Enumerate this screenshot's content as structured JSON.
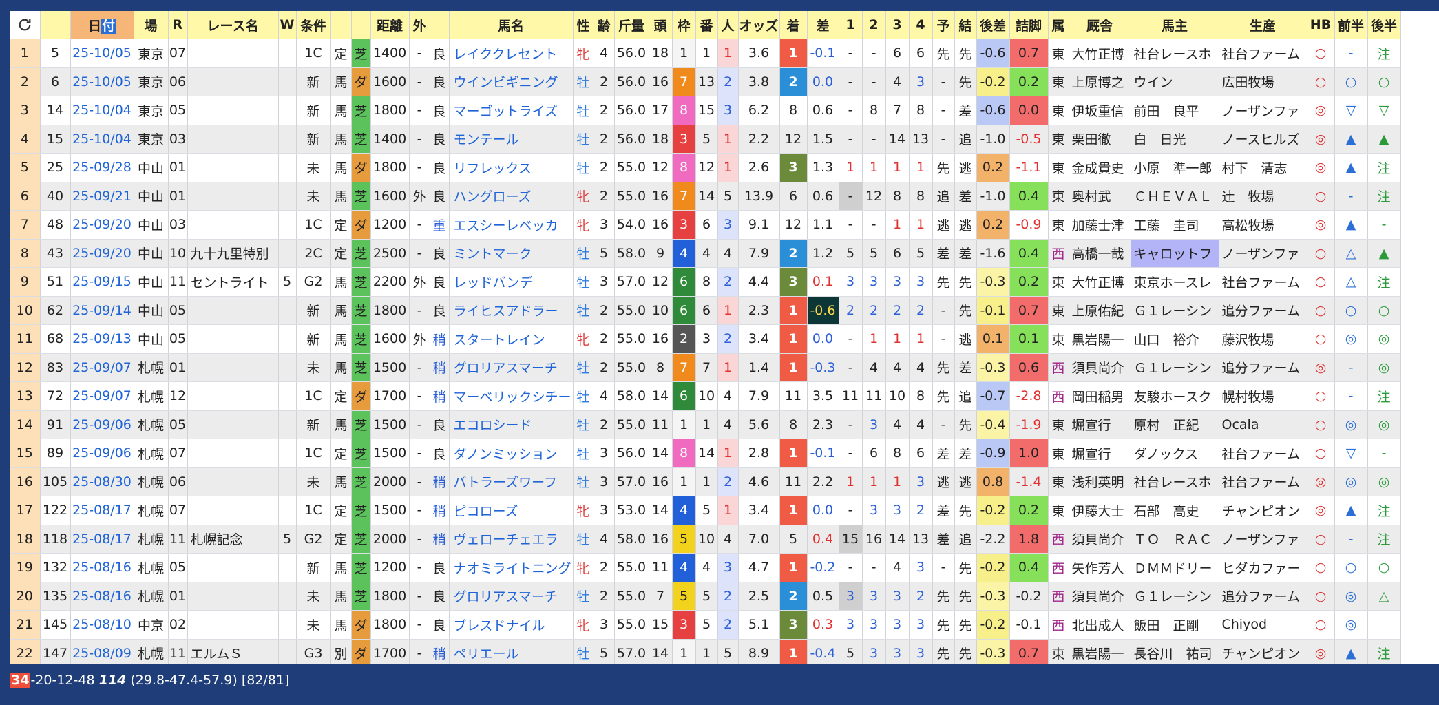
{
  "headers": [
    "日付",
    "場",
    "R",
    "レース名",
    "W",
    "条件",
    "",
    "",
    "距離",
    "外",
    "",
    "馬名",
    "性",
    "齢",
    "斤量",
    "頭",
    "枠",
    "番",
    "人",
    "オッズ",
    "着",
    "差",
    "1",
    "2",
    "3",
    "4",
    "予",
    "結",
    "後差",
    "詰脚",
    "属",
    "厩舎",
    "馬主",
    "生産",
    "HB",
    "前半",
    "後半"
  ],
  "header_date_prefix": "日",
  "header_date_selected": "付",
  "rows": [
    {
      "n": "1",
      "id": "5",
      "date": "25-10/05",
      "ba": "東京",
      "r": "07",
      "name": "",
      "w": "",
      "jo": "1C",
      "t": "定",
      "surf": "芝",
      "dist": "1400",
      "out": "-",
      "baba": "良",
      "horse": "レイククレセント",
      "sex": "牝",
      "age": "4",
      "kin": "56.0",
      "to": "18",
      "waku": "1",
      "ban": "1",
      "nin": "1",
      "odds": "3.6",
      "chaku": "1",
      "sa": "-0.1",
      "c1": "-",
      "c2": "-",
      "c3": "6",
      "c4": "6",
      "yo": "先",
      "ke": "先",
      "ato": "-0.6",
      "tsume": "0.7",
      "zoku": "東",
      "kyu": "大竹正博",
      "owner": "社台レースホ",
      "prod": "社台ファーム",
      "hb": "○",
      "zen": "-",
      "kou": "注"
    },
    {
      "n": "2",
      "id": "6",
      "date": "25-10/05",
      "ba": "東京",
      "r": "06",
      "name": "",
      "w": "",
      "jo": "新",
      "t": "馬",
      "surf": "ダ",
      "dist": "1600",
      "out": "-",
      "baba": "良",
      "horse": "ウインビギニング",
      "sex": "牡",
      "age": "2",
      "kin": "56.0",
      "to": "16",
      "waku": "7",
      "ban": "13",
      "nin": "2",
      "odds": "3.8",
      "chaku": "2",
      "sa": "0.0",
      "c1": "-",
      "c2": "-",
      "c3": "4",
      "c4": "3",
      "yo": "-",
      "ke": "先",
      "ato": "-0.2",
      "tsume": "0.2",
      "zoku": "東",
      "kyu": "上原博之",
      "owner": "ウイン",
      "prod": "広田牧場",
      "hb": "○",
      "zen": "○",
      "kou": "○"
    },
    {
      "n": "3",
      "id": "14",
      "date": "25-10/04",
      "ba": "東京",
      "r": "05",
      "name": "",
      "w": "",
      "jo": "新",
      "t": "馬",
      "surf": "芝",
      "dist": "1800",
      "out": "-",
      "baba": "良",
      "horse": "マーゴットライズ",
      "sex": "牡",
      "age": "2",
      "kin": "56.0",
      "to": "17",
      "waku": "8",
      "ban": "15",
      "nin": "3",
      "odds": "6.2",
      "chaku": "8",
      "sa": "0.6",
      "c1": "-",
      "c2": "8",
      "c3": "7",
      "c4": "8",
      "yo": "-",
      "ke": "差",
      "ato": "-0.6",
      "tsume": "0.0",
      "zoku": "東",
      "kyu": "伊坂重信",
      "owner": "前田　良平",
      "prod": "ノーザンファ",
      "hb": "◎",
      "zen": "▽",
      "kou": "▽"
    },
    {
      "n": "4",
      "id": "15",
      "date": "25-10/04",
      "ba": "東京",
      "r": "03",
      "name": "",
      "w": "",
      "jo": "新",
      "t": "馬",
      "surf": "芝",
      "dist": "1400",
      "out": "-",
      "baba": "良",
      "horse": "モンテール",
      "sex": "牡",
      "age": "2",
      "kin": "56.0",
      "to": "18",
      "waku": "3",
      "ban": "5",
      "nin": "1",
      "odds": "2.2",
      "chaku": "12",
      "sa": "1.5",
      "c1": "-",
      "c2": "-",
      "c3": "14",
      "c4": "13",
      "yo": "-",
      "ke": "追",
      "ato": "-1.0",
      "tsume": "-0.5",
      "zoku": "東",
      "kyu": "栗田徹",
      "owner": "白　日光",
      "prod": "ノースヒルズ",
      "hb": "◎",
      "zen": "▲",
      "kou": "▲"
    },
    {
      "n": "5",
      "id": "25",
      "date": "25-09/28",
      "ba": "中山",
      "r": "01",
      "name": "",
      "w": "",
      "jo": "未",
      "t": "馬",
      "surf": "ダ",
      "dist": "1800",
      "out": "-",
      "baba": "良",
      "horse": "リフレックス",
      "sex": "牡",
      "age": "2",
      "kin": "55.0",
      "to": "12",
      "waku": "8",
      "ban": "12",
      "nin": "1",
      "odds": "2.6",
      "chaku": "3",
      "sa": "1.3",
      "c1": "1",
      "c2": "1",
      "c3": "1",
      "c4": "1",
      "yo": "先",
      "ke": "逃",
      "ato": "0.2",
      "tsume": "-1.1",
      "zoku": "東",
      "kyu": "金成貴史",
      "owner": "小原　準一郎",
      "prod": "村下　清志",
      "hb": "◎",
      "zen": "▲",
      "kou": "注"
    },
    {
      "n": "6",
      "id": "40",
      "date": "25-09/21",
      "ba": "中山",
      "r": "01",
      "name": "",
      "w": "",
      "jo": "未",
      "t": "馬",
      "surf": "芝",
      "dist": "1600",
      "out": "外",
      "baba": "良",
      "horse": "ハングローズ",
      "sex": "牝",
      "age": "2",
      "kin": "55.0",
      "to": "16",
      "waku": "7",
      "ban": "14",
      "nin": "5",
      "odds": "13.9",
      "chaku": "6",
      "sa": "0.6",
      "c1": "-",
      "c2": "12",
      "c3": "8",
      "c4": "8",
      "yo": "追",
      "ke": "差",
      "ato": "-1.0",
      "tsume": "0.4",
      "zoku": "東",
      "kyu": "奥村武",
      "owner": "ＣＨＥＶＡＬ",
      "prod": "辻　牧場",
      "hb": "○",
      "zen": "-",
      "kou": "注"
    },
    {
      "n": "7",
      "id": "48",
      "date": "25-09/20",
      "ba": "中山",
      "r": "03",
      "name": "",
      "w": "",
      "jo": "1C",
      "t": "定",
      "surf": "ダ",
      "dist": "1200",
      "out": "-",
      "baba": "重",
      "horse": "エスシーレベッカ",
      "sex": "牝",
      "age": "3",
      "kin": "54.0",
      "to": "16",
      "waku": "3",
      "ban": "6",
      "nin": "3",
      "odds": "9.1",
      "chaku": "12",
      "sa": "1.1",
      "c1": "-",
      "c2": "-",
      "c3": "1",
      "c4": "1",
      "yo": "逃",
      "ke": "逃",
      "ato": "0.2",
      "tsume": "-0.9",
      "zoku": "東",
      "kyu": "加藤士津",
      "owner": "工藤　圭司",
      "prod": "高松牧場",
      "hb": "◎",
      "zen": "▲",
      "kou": "-"
    },
    {
      "n": "8",
      "id": "43",
      "date": "25-09/20",
      "ba": "中山",
      "r": "10",
      "name": "九十九里特別",
      "w": "",
      "jo": "2C",
      "t": "定",
      "surf": "芝",
      "dist": "2500",
      "out": "-",
      "baba": "良",
      "horse": "ミントマーク",
      "sex": "牡",
      "age": "5",
      "kin": "58.0",
      "to": "9",
      "waku": "4",
      "ban": "4",
      "nin": "4",
      "odds": "7.9",
      "chaku": "2",
      "sa": "1.2",
      "c1": "5",
      "c2": "5",
      "c3": "6",
      "c4": "5",
      "yo": "差",
      "ke": "差",
      "ato": "-1.6",
      "tsume": "0.4",
      "zoku": "西",
      "kyu": "高橋一哉",
      "owner": "キャロットフ",
      "prod": "ノーザンファ",
      "hb": "○",
      "zen": "△",
      "kou": "▲"
    },
    {
      "n": "9",
      "id": "51",
      "date": "25-09/15",
      "ba": "中山",
      "r": "11",
      "name": "セントライト",
      "w": "5",
      "jo": "G2",
      "t": "馬",
      "surf": "芝",
      "dist": "2200",
      "out": "外",
      "baba": "良",
      "horse": "レッドバンデ",
      "sex": "牡",
      "age": "3",
      "kin": "57.0",
      "to": "12",
      "waku": "6",
      "ban": "8",
      "nin": "2",
      "odds": "4.4",
      "chaku": "3",
      "sa": "0.1",
      "c1": "3",
      "c2": "3",
      "c3": "3",
      "c4": "3",
      "yo": "先",
      "ke": "先",
      "ato": "-0.3",
      "tsume": "0.2",
      "zoku": "東",
      "kyu": "大竹正博",
      "owner": "東京ホースレ",
      "prod": "社台ファーム",
      "hb": "○",
      "zen": "△",
      "kou": "注"
    },
    {
      "n": "10",
      "id": "62",
      "date": "25-09/14",
      "ba": "中山",
      "r": "05",
      "name": "",
      "w": "",
      "jo": "新",
      "t": "馬",
      "surf": "芝",
      "dist": "1800",
      "out": "-",
      "baba": "良",
      "horse": "ライヒスアドラー",
      "sex": "牡",
      "age": "2",
      "kin": "55.0",
      "to": "10",
      "waku": "6",
      "ban": "6",
      "nin": "1",
      "odds": "2.3",
      "chaku": "1",
      "sa": "-0.6",
      "c1": "2",
      "c2": "2",
      "c3": "2",
      "c4": "2",
      "yo": "-",
      "ke": "先",
      "ato": "-0.1",
      "tsume": "0.7",
      "zoku": "東",
      "kyu": "上原佑紀",
      "owner": "Ｇ１レーシン",
      "prod": "追分ファーム",
      "hb": "○",
      "zen": "○",
      "kou": "○"
    },
    {
      "n": "11",
      "id": "68",
      "date": "25-09/13",
      "ba": "中山",
      "r": "05",
      "name": "",
      "w": "",
      "jo": "新",
      "t": "馬",
      "surf": "芝",
      "dist": "1600",
      "out": "外",
      "baba": "稍",
      "horse": "スタートレイン",
      "sex": "牝",
      "age": "2",
      "kin": "55.0",
      "to": "16",
      "waku": "2",
      "ban": "3",
      "nin": "2",
      "odds": "3.4",
      "chaku": "1",
      "sa": "0.0",
      "c1": "-",
      "c2": "1",
      "c3": "1",
      "c4": "1",
      "yo": "-",
      "ke": "逃",
      "ato": "0.1",
      "tsume": "0.1",
      "zoku": "東",
      "kyu": "黒岩陽一",
      "owner": "山口　裕介",
      "prod": "藤沢牧場",
      "hb": "○",
      "zen": "◎",
      "kou": "◎"
    },
    {
      "n": "12",
      "id": "83",
      "date": "25-09/07",
      "ba": "札幌",
      "r": "01",
      "name": "",
      "w": "",
      "jo": "未",
      "t": "馬",
      "surf": "芝",
      "dist": "1500",
      "out": "-",
      "baba": "稍",
      "horse": "グロリアスマーチ",
      "sex": "牡",
      "age": "2",
      "kin": "55.0",
      "to": "8",
      "waku": "7",
      "ban": "7",
      "nin": "1",
      "odds": "1.4",
      "chaku": "1",
      "sa": "-0.3",
      "c1": "-",
      "c2": "4",
      "c3": "4",
      "c4": "4",
      "yo": "先",
      "ke": "差",
      "ato": "-0.3",
      "tsume": "0.6",
      "zoku": "西",
      "kyu": "須貝尚介",
      "owner": "Ｇ１レーシン",
      "prod": "追分ファーム",
      "hb": "◎",
      "zen": "-",
      "kou": "◎"
    },
    {
      "n": "13",
      "id": "72",
      "date": "25-09/07",
      "ba": "札幌",
      "r": "12",
      "name": "",
      "w": "",
      "jo": "1C",
      "t": "定",
      "surf": "ダ",
      "dist": "1700",
      "out": "-",
      "baba": "稍",
      "horse": "マーベリックシチー",
      "sex": "牡",
      "age": "4",
      "kin": "58.0",
      "to": "14",
      "waku": "6",
      "ban": "10",
      "nin": "4",
      "odds": "7.9",
      "chaku": "11",
      "sa": "3.5",
      "c1": "11",
      "c2": "11",
      "c3": "10",
      "c4": "8",
      "yo": "先",
      "ke": "追",
      "ato": "-0.7",
      "tsume": "-2.8",
      "zoku": "西",
      "kyu": "岡田稲男",
      "owner": "友駿ホースク",
      "prod": "幌村牧場",
      "hb": "○",
      "zen": "-",
      "kou": "注"
    },
    {
      "n": "14",
      "id": "91",
      "date": "25-09/06",
      "ba": "札幌",
      "r": "05",
      "name": "",
      "w": "",
      "jo": "新",
      "t": "馬",
      "surf": "芝",
      "dist": "1500",
      "out": "-",
      "baba": "良",
      "horse": "エコロシード",
      "sex": "牡",
      "age": "2",
      "kin": "55.0",
      "to": "11",
      "waku": "1",
      "ban": "1",
      "nin": "4",
      "odds": "5.6",
      "chaku": "8",
      "sa": "2.3",
      "c1": "-",
      "c2": "3",
      "c3": "4",
      "c4": "4",
      "yo": "-",
      "ke": "先",
      "ato": "-0.4",
      "tsume": "-1.9",
      "zoku": "東",
      "kyu": "堀宣行",
      "owner": "原村　正紀",
      "prod": "Ocala",
      "hb": "○",
      "zen": "◎",
      "kou": "◎"
    },
    {
      "n": "15",
      "id": "89",
      "date": "25-09/06",
      "ba": "札幌",
      "r": "07",
      "name": "",
      "w": "",
      "jo": "1C",
      "t": "定",
      "surf": "芝",
      "dist": "1500",
      "out": "-",
      "baba": "良",
      "horse": "ダノンミッション",
      "sex": "牡",
      "age": "3",
      "kin": "56.0",
      "to": "14",
      "waku": "8",
      "ban": "14",
      "nin": "1",
      "odds": "2.8",
      "chaku": "1",
      "sa": "-0.1",
      "c1": "-",
      "c2": "6",
      "c3": "8",
      "c4": "6",
      "yo": "差",
      "ke": "差",
      "ato": "-0.9",
      "tsume": "1.0",
      "zoku": "東",
      "kyu": "堀宣行",
      "owner": "ダノックス",
      "prod": "社台ファーム",
      "hb": "○",
      "zen": "▽",
      "kou": "-"
    },
    {
      "n": "16",
      "id": "105",
      "date": "25-08/30",
      "ba": "札幌",
      "r": "06",
      "name": "",
      "w": "",
      "jo": "未",
      "t": "馬",
      "surf": "芝",
      "dist": "2000",
      "out": "-",
      "baba": "稍",
      "horse": "バトラーズワーフ",
      "sex": "牡",
      "age": "3",
      "kin": "57.0",
      "to": "16",
      "waku": "1",
      "ban": "1",
      "nin": "2",
      "odds": "4.6",
      "chaku": "11",
      "sa": "2.2",
      "c1": "1",
      "c2": "1",
      "c3": "1",
      "c4": "3",
      "yo": "逃",
      "ke": "逃",
      "ato": "0.8",
      "tsume": "-1.4",
      "zoku": "東",
      "kyu": "浅利英明",
      "owner": "社台レースホ",
      "prod": "社台ファーム",
      "hb": "◎",
      "zen": "◎",
      "kou": "◎"
    },
    {
      "n": "17",
      "id": "122",
      "date": "25-08/17",
      "ba": "札幌",
      "r": "07",
      "name": "",
      "w": "",
      "jo": "1C",
      "t": "定",
      "surf": "芝",
      "dist": "1500",
      "out": "-",
      "baba": "稍",
      "horse": "ピコローズ",
      "sex": "牝",
      "age": "3",
      "kin": "53.0",
      "to": "14",
      "waku": "4",
      "ban": "5",
      "nin": "1",
      "odds": "3.4",
      "chaku": "1",
      "sa": "0.0",
      "c1": "-",
      "c2": "3",
      "c3": "3",
      "c4": "2",
      "yo": "差",
      "ke": "先",
      "ato": "-0.2",
      "tsume": "0.2",
      "zoku": "東",
      "kyu": "伊藤大士",
      "owner": "石部　高史",
      "prod": "チャンピオン",
      "hb": "◎",
      "zen": "▲",
      "kou": "注"
    },
    {
      "n": "18",
      "id": "118",
      "date": "25-08/17",
      "ba": "札幌",
      "r": "11",
      "name": "札幌記念",
      "w": "5",
      "jo": "G2",
      "t": "定",
      "surf": "芝",
      "dist": "2000",
      "out": "-",
      "baba": "稍",
      "horse": "ヴェローチェエラ",
      "sex": "牡",
      "age": "4",
      "kin": "58.0",
      "to": "16",
      "waku": "5",
      "ban": "10",
      "nin": "4",
      "odds": "7.0",
      "chaku": "5",
      "sa": "0.4",
      "c1": "15",
      "c2": "16",
      "c3": "14",
      "c4": "13",
      "yo": "差",
      "ke": "追",
      "ato": "-2.2",
      "tsume": "1.8",
      "zoku": "西",
      "kyu": "須貝尚介",
      "owner": "ＴＯ　ＲＡＣ",
      "prod": "ノーザンファ",
      "hb": "○",
      "zen": "-",
      "kou": "注"
    },
    {
      "n": "19",
      "id": "132",
      "date": "25-08/16",
      "ba": "札幌",
      "r": "05",
      "name": "",
      "w": "",
      "jo": "新",
      "t": "馬",
      "surf": "芝",
      "dist": "1200",
      "out": "-",
      "baba": "良",
      "horse": "ナオミライトニング",
      "sex": "牝",
      "age": "2",
      "kin": "55.0",
      "to": "11",
      "waku": "4",
      "ban": "4",
      "nin": "3",
      "odds": "4.7",
      "chaku": "1",
      "sa": "-0.2",
      "c1": "-",
      "c2": "-",
      "c3": "4",
      "c4": "3",
      "yo": "-",
      "ke": "先",
      "ato": "-0.2",
      "tsume": "0.4",
      "zoku": "西",
      "kyu": "矢作芳人",
      "owner": "ＤＭＭドリー",
      "prod": "ヒダカファー",
      "hb": "○",
      "zen": "○",
      "kou": "○"
    },
    {
      "n": "20",
      "id": "135",
      "date": "25-08/16",
      "ba": "札幌",
      "r": "01",
      "name": "",
      "w": "",
      "jo": "未",
      "t": "馬",
      "surf": "芝",
      "dist": "1800",
      "out": "-",
      "baba": "良",
      "horse": "グロリアスマーチ",
      "sex": "牡",
      "age": "2",
      "kin": "55.0",
      "to": "7",
      "waku": "5",
      "ban": "5",
      "nin": "2",
      "odds": "2.5",
      "chaku": "2",
      "sa": "0.5",
      "c1": "3",
      "c2": "3",
      "c3": "3",
      "c4": "2",
      "yo": "先",
      "ke": "先",
      "ato": "-0.3",
      "tsume": "-0.2",
      "zoku": "西",
      "kyu": "須貝尚介",
      "owner": "Ｇ１レーシン",
      "prod": "追分ファーム",
      "hb": "○",
      "zen": "◎",
      "kou": "△"
    },
    {
      "n": "21",
      "id": "145",
      "date": "25-08/10",
      "ba": "中京",
      "r": "02",
      "name": "",
      "w": "",
      "jo": "未",
      "t": "馬",
      "surf": "ダ",
      "dist": "1800",
      "out": "-",
      "baba": "良",
      "horse": "ブレスドナイル",
      "sex": "牝",
      "age": "3",
      "kin": "55.0",
      "to": "15",
      "waku": "3",
      "ban": "5",
      "nin": "2",
      "odds": "5.1",
      "chaku": "3",
      "sa": "0.3",
      "c1": "3",
      "c2": "3",
      "c3": "3",
      "c4": "3",
      "yo": "先",
      "ke": "先",
      "ato": "-0.2",
      "tsume": "-0.1",
      "zoku": "西",
      "kyu": "北出成人",
      "owner": "飯田　正剛",
      "prod": "Chiyod",
      "hb": "○",
      "zen": "◎",
      "kou": ""
    },
    {
      "n": "22",
      "id": "147",
      "date": "25-08/09",
      "ba": "札幌",
      "r": "11",
      "name": "エルムＳ",
      "w": "",
      "jo": "G3",
      "t": "別",
      "surf": "ダ",
      "dist": "1700",
      "out": "-",
      "baba": "稍",
      "horse": "ペリエール",
      "sex": "牡",
      "age": "5",
      "kin": "57.0",
      "to": "14",
      "waku": "1",
      "ban": "1",
      "nin": "5",
      "odds": "8.9",
      "chaku": "1",
      "sa": "-0.4",
      "c1": "5",
      "c2": "3",
      "c3": "3",
      "c4": "3",
      "yo": "先",
      "ke": "先",
      "ato": "-0.3",
      "tsume": "0.7",
      "zoku": "東",
      "kyu": "黒岩陽一",
      "owner": "長谷川　祐司",
      "prod": "チャンピオン",
      "hb": "◎",
      "zen": "▲",
      "kou": "注"
    }
  ],
  "status": {
    "highlight": "34",
    "rest": "-20-12-48",
    "bold": "114",
    "tail": "(29.8-47.4-57.9) [82/81]"
  },
  "icons": {
    "refresh": "refresh-icon"
  }
}
